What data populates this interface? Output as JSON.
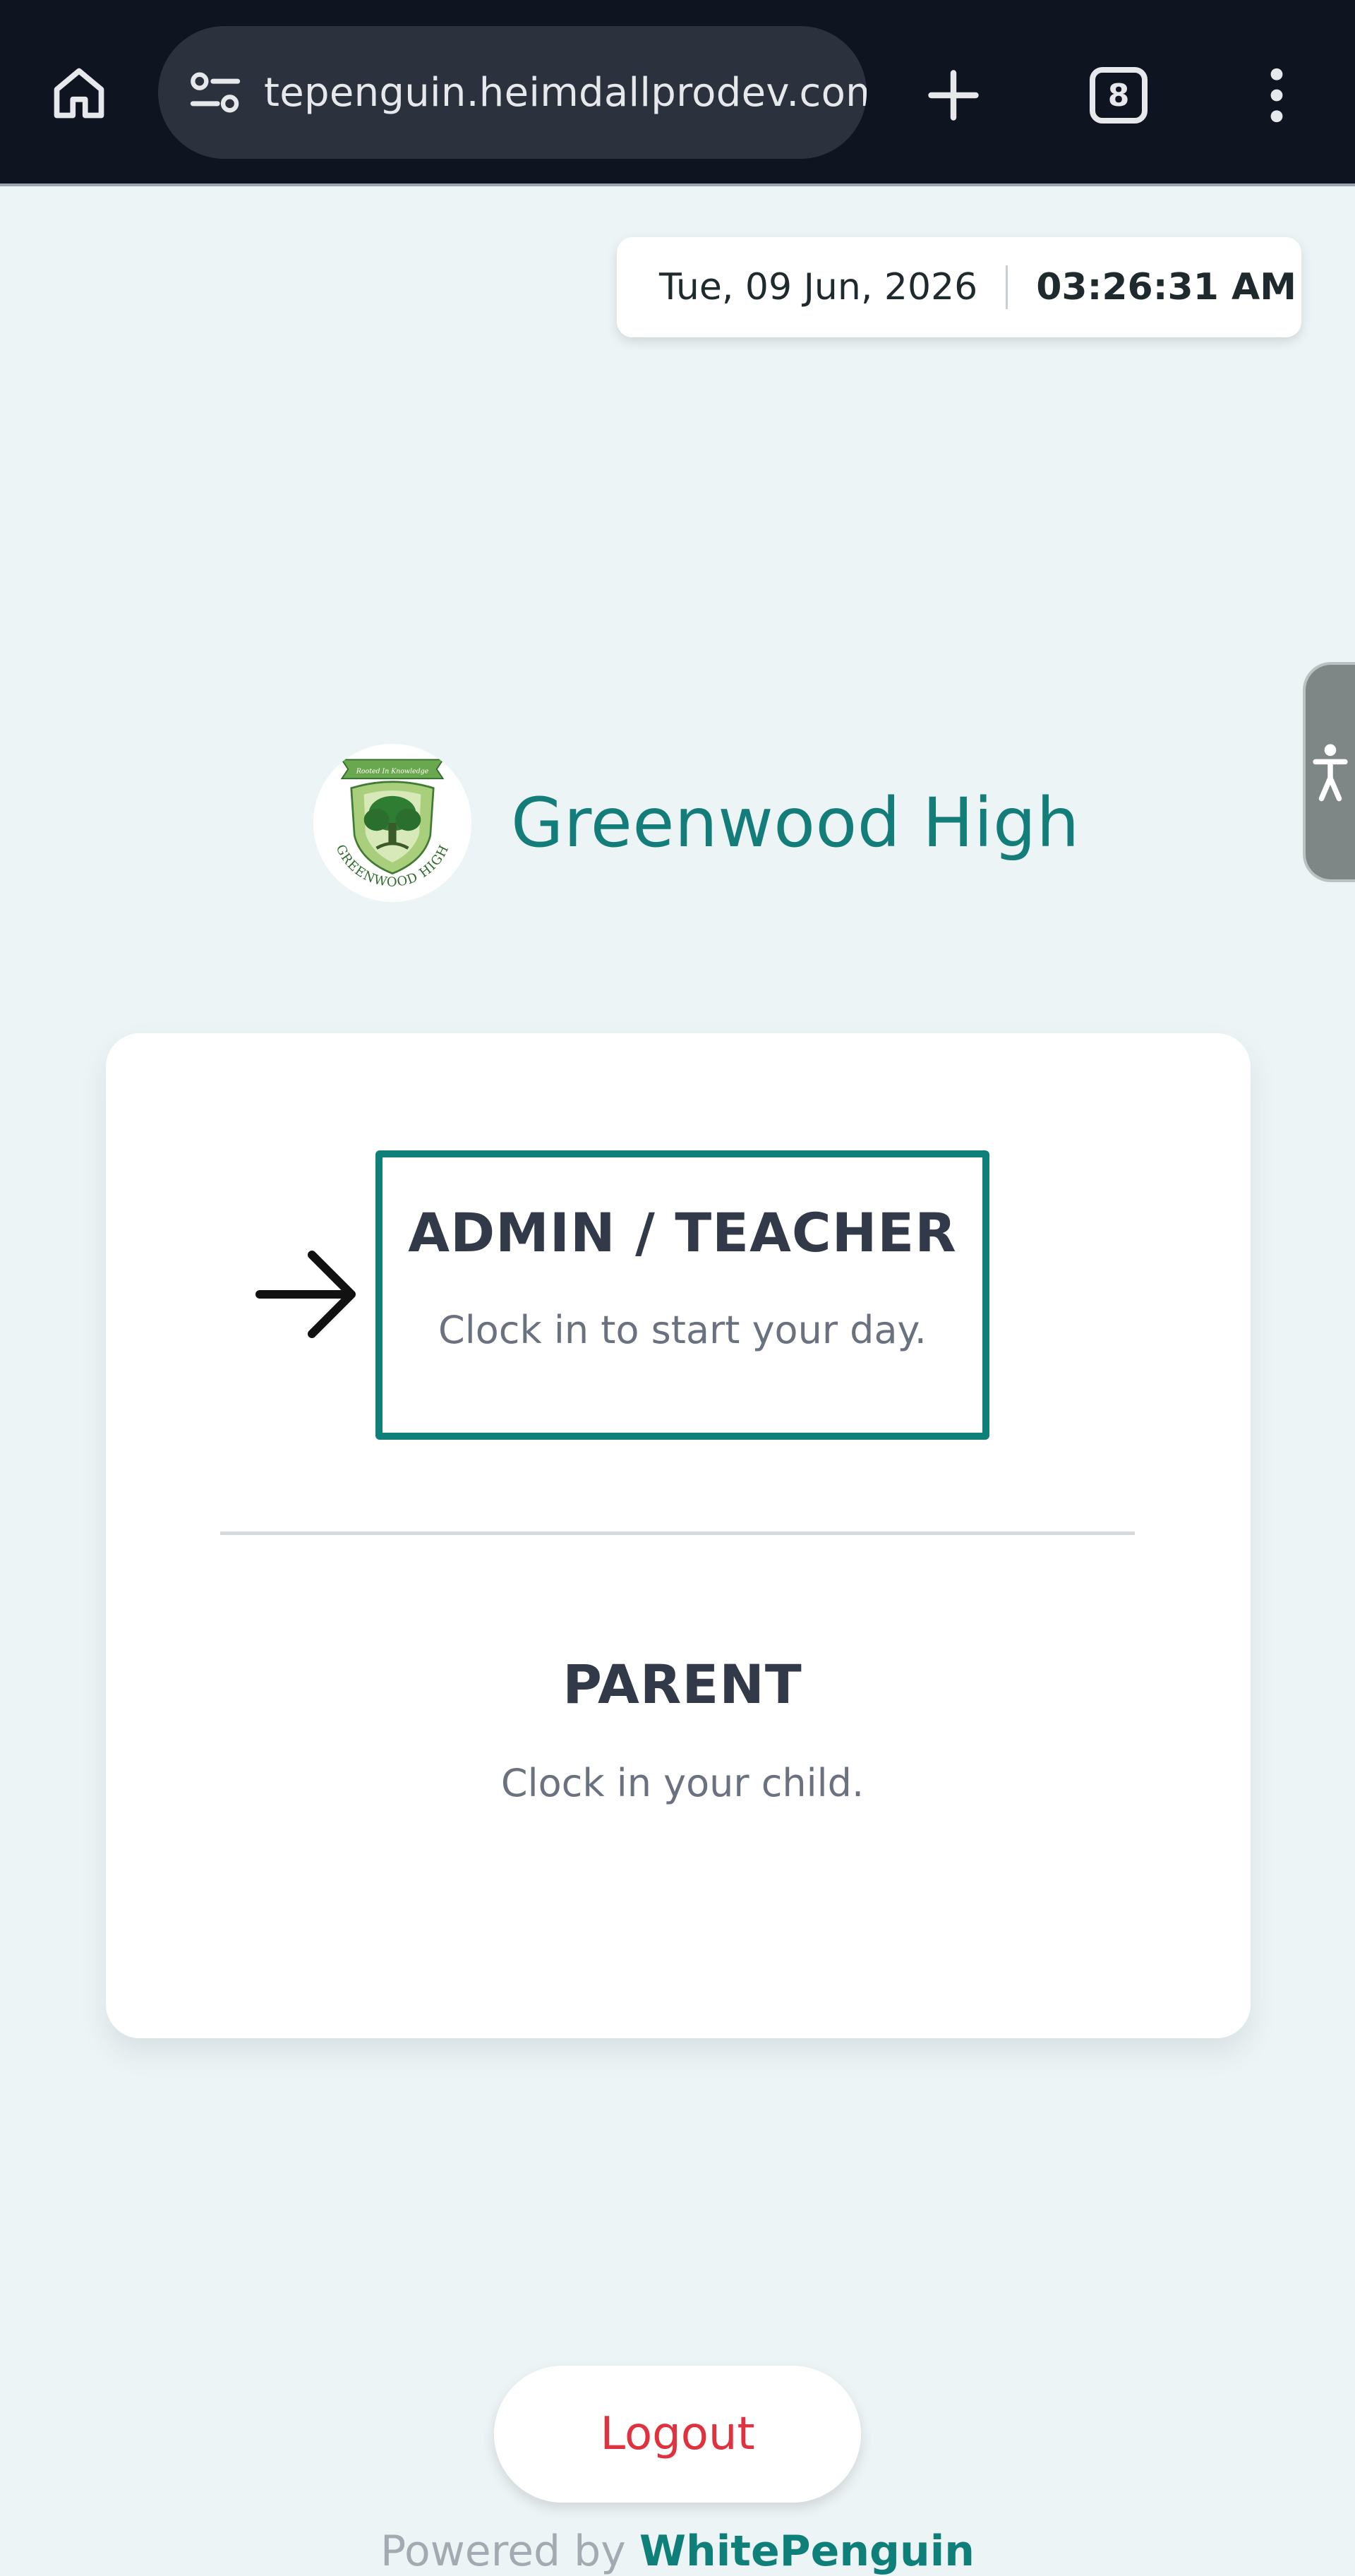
{
  "browser": {
    "url": "tepenguin.heimdallprodev.com",
    "tab_count": "8"
  },
  "datetime": {
    "date": "Tue, 09 Jun, 2026",
    "time": "03:26:31 AM"
  },
  "school": {
    "name": "Greenwood High",
    "logo_motto": "Rooted In Knowledge",
    "logo_text": "GREENWOOD HIGH"
  },
  "options": {
    "admin": {
      "title": "ADMIN / TEACHER",
      "subtitle": "Clock in to start your day."
    },
    "parent": {
      "title": "PARENT",
      "subtitle": "Clock in your child."
    }
  },
  "logout": {
    "label": "Logout"
  },
  "footer": {
    "prefix": "Powered by",
    "brand": "WhitePenguin"
  },
  "colors": {
    "accent": "#0f7f7a",
    "logout": "#e0313f",
    "background": "#edf4f6"
  },
  "icons": {
    "home": "home-icon",
    "site_settings": "tune-icon",
    "new_tab": "plus-icon",
    "menu": "more-vertical-icon",
    "accessibility": "accessibility-icon",
    "pointer": "arrow-right-icon"
  }
}
